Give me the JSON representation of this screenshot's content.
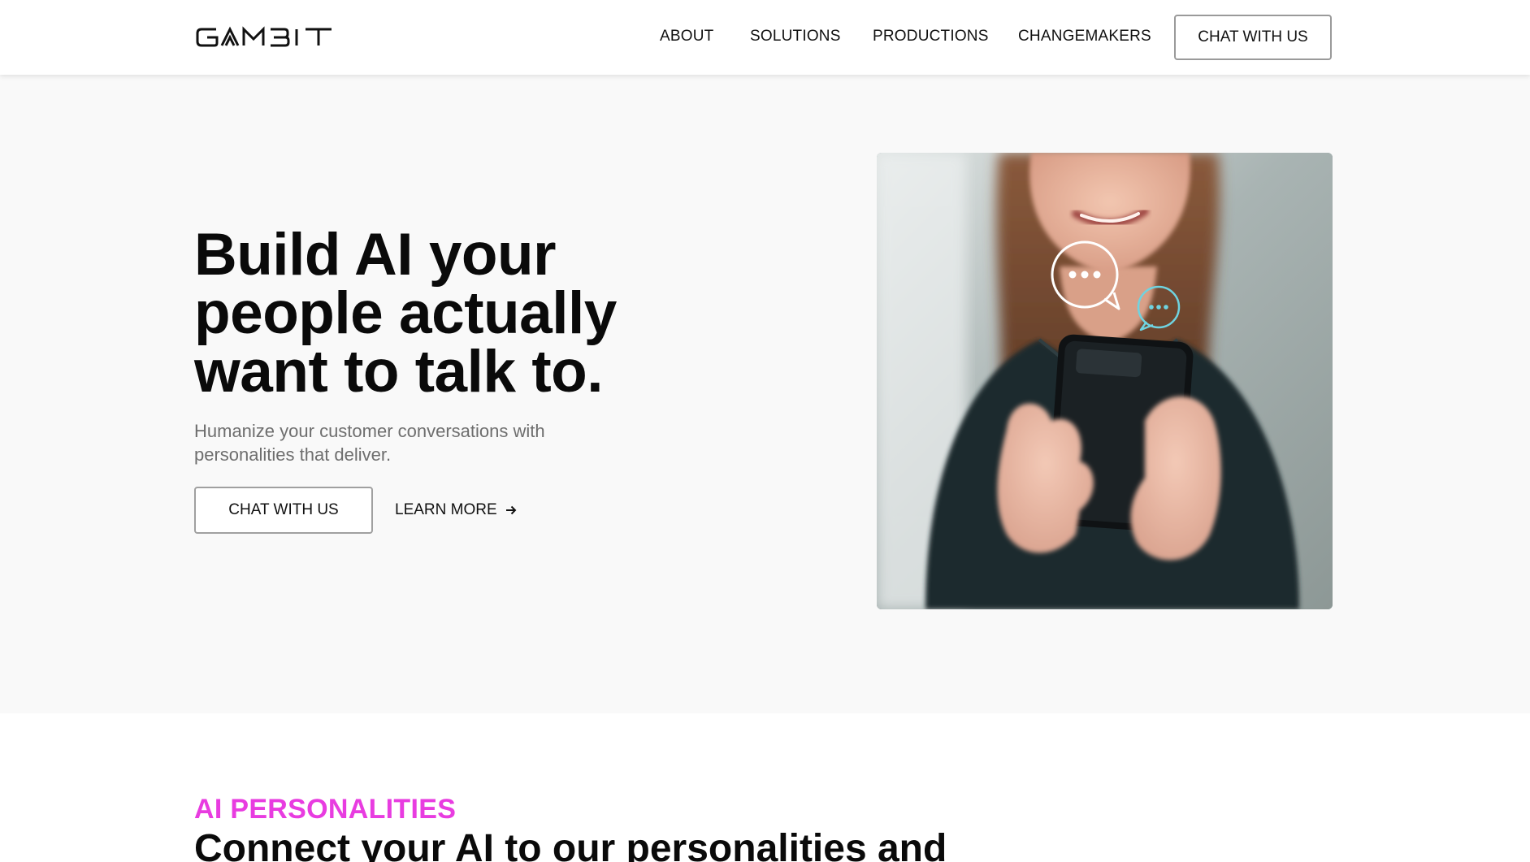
{
  "brand": {
    "logo_text": "GAMBIT"
  },
  "nav": {
    "items": [
      {
        "label": "ABOUT"
      },
      {
        "label": "SOLUTIONS"
      },
      {
        "label": "PRODUCTIONS"
      },
      {
        "label": "CHANGEMAKERS"
      }
    ],
    "cta_label": "CHAT WITH US"
  },
  "hero": {
    "title_lines": [
      "Build AI your",
      "people actually",
      "want to talk to."
    ],
    "subtitle": "Humanize your customer conversations with personalities that deliver.",
    "primary_cta": "CHAT WITH US",
    "secondary_cta": "LEARN MORE",
    "secondary_cta_icon": "arrow-right-icon",
    "image_alt_icons": [
      "chat-bubble-white-icon",
      "chat-bubble-cyan-icon"
    ]
  },
  "section": {
    "eyebrow": "AI PERSONALITIES",
    "title": "Connect your AI to our personalities and"
  },
  "colors": {
    "accent": "#e83ce0",
    "hero_bg": "#f9f9f9",
    "text_muted": "#6e6e6e",
    "chat_cyan": "#6fd3e0"
  }
}
